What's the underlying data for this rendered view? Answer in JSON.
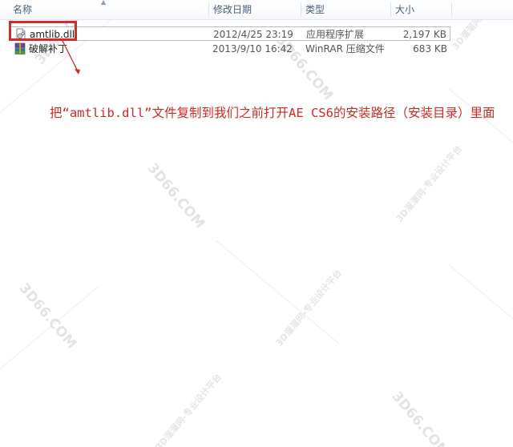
{
  "columns": {
    "name": "名称",
    "date_modified": "修改日期",
    "type": "类型",
    "size": "大小"
  },
  "files": [
    {
      "name": "amtlib.dll",
      "date_modified": "2012/4/25 23:19",
      "type": "应用程序扩展",
      "size": "2,197 KB",
      "icon": "dll-file-icon",
      "selected": true
    },
    {
      "name": "破解补丁",
      "date_modified": "2013/9/10 16:42",
      "type": "WinRAR 压缩文件",
      "size": "683 KB",
      "icon": "winrar-archive-icon",
      "selected": false
    }
  ],
  "annotation": {
    "instruction": "把“amtlib.dll”文件复制到我们之前打开AE CS6的安装路径（安装目录）里面",
    "color": "#cc2a24"
  },
  "watermarks": {
    "site": "3D66.COM",
    "cn": "3D溜溜网-专业设计平台"
  }
}
